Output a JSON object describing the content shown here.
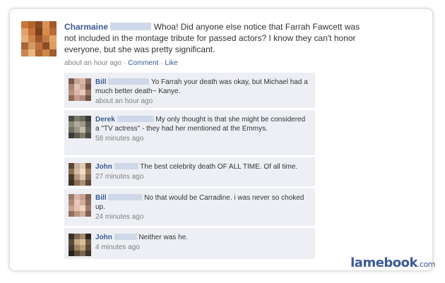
{
  "post": {
    "author": "Charmaine",
    "text": "Whoa! Did anyone else notice that Farrah Fawcett was not included in the montage tribute for passed actors? I know they can't honor everyone, but she was pretty significant.",
    "time": "about an hour ago",
    "separator": "·",
    "comment_label": "Comment",
    "like_label": "Like"
  },
  "comments": [
    {
      "author": "Bill",
      "text": "Yo Farrah your death was okay, but Michael had a much better death~ Kanye.",
      "time": "about an hour ago"
    },
    {
      "author": "Derek",
      "text": "My only thought is that she might be considered a \"TV actress\" - they had her mentioned at the Emmys.",
      "time": "58 minutes ago"
    },
    {
      "author": "John",
      "text": "The best celebrity death OF ALL TIME. Of all time.",
      "time": "27 minutes ago"
    },
    {
      "author": "Bill",
      "text": "No that would be Carradine. i was never so choked up.",
      "time": "24 minutes ago"
    },
    {
      "author": "John",
      "text": "Neither was he.",
      "time": "4 minutes ago"
    }
  ],
  "watermark": {
    "brand": "lamebook",
    "tld": ".com"
  },
  "colors": {
    "link": "#3b5998",
    "comment_bg": "#edeff4",
    "muted": "#808080"
  }
}
